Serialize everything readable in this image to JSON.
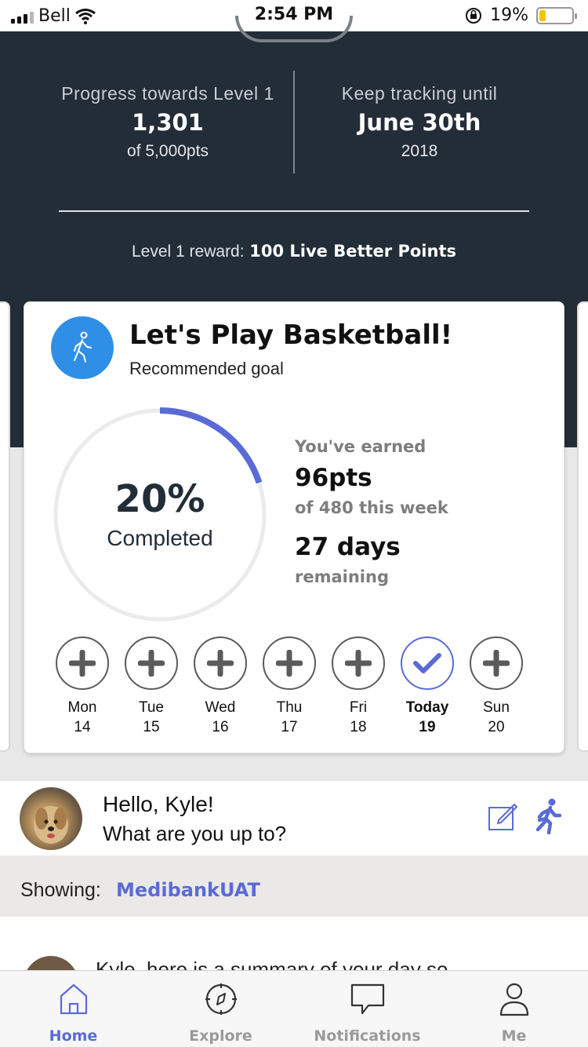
{
  "status_bar": {
    "carrier": "Bell",
    "time": "2:54 PM",
    "battery_percent": "19%",
    "battery_level": 0.19,
    "battery_color": "#f5c400",
    "icons": [
      "signal-icon",
      "wifi-icon",
      "orientation-lock-icon",
      "battery-icon"
    ]
  },
  "progress": {
    "left_label": "Progress towards Level 1",
    "left_value": "1,301",
    "left_sub": "of 5,000pts",
    "right_label": "Keep tracking until",
    "right_value": "June 30th",
    "right_sub": "2018",
    "reward_label": "Level 1 reward:",
    "reward_value": "100 Live Better Points"
  },
  "goal_card": {
    "icon": "walking-person-icon",
    "title": "Let's Play Basketball!",
    "subtitle": "Recommended goal",
    "percent_text": "20%",
    "percent_value": 0.2,
    "completed_label": "Completed",
    "earned_label": "You've earned",
    "earned_value": "96pts",
    "earned_sub": "of 480 this week",
    "days_value": "27 days",
    "days_label": "remaining",
    "accent_color": "#5a6bd6",
    "icon_bg_color": "#2f8fe6",
    "days": [
      {
        "name": "Mon",
        "num": "14",
        "state": "add"
      },
      {
        "name": "Tue",
        "num": "15",
        "state": "add"
      },
      {
        "name": "Wed",
        "num": "16",
        "state": "add"
      },
      {
        "name": "Thu",
        "num": "17",
        "state": "add"
      },
      {
        "name": "Fri",
        "num": "18",
        "state": "add"
      },
      {
        "name": "Today",
        "num": "19",
        "state": "checked"
      },
      {
        "name": "Sun",
        "num": "20",
        "state": "add"
      }
    ]
  },
  "hello": {
    "greeting": "Hello, Kyle!",
    "prompt": "What are you up to?"
  },
  "showing": {
    "label": "Showing:",
    "value": "MedibankUAT"
  },
  "feed": {
    "partial_text": "Kyle, here is a summary of your day so"
  },
  "tabs": [
    {
      "label": "Home",
      "icon": "home-icon",
      "active": true
    },
    {
      "label": "Explore",
      "icon": "compass-icon",
      "active": false
    },
    {
      "label": "Notifications",
      "icon": "chat-bubble-icon",
      "active": false
    },
    {
      "label": "Me",
      "icon": "person-icon",
      "active": false
    }
  ]
}
